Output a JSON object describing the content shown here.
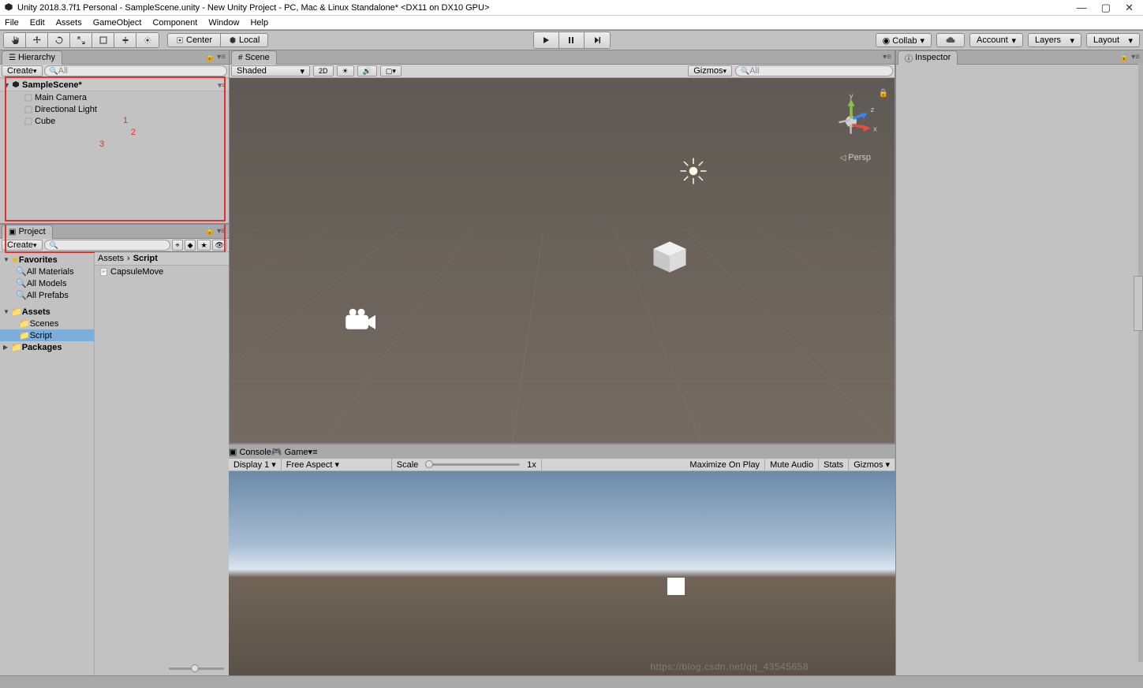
{
  "window": {
    "title": "Unity 2018.3.7f1 Personal - SampleScene.unity - New Unity Project - PC, Mac & Linux Standalone* <DX11 on DX10 GPU>"
  },
  "menu": [
    "File",
    "Edit",
    "Assets",
    "GameObject",
    "Component",
    "Window",
    "Help"
  ],
  "toolbar": {
    "center": "Center",
    "local": "Local",
    "collab": "Collab",
    "account": "Account",
    "layers": "Layers",
    "layout": "Layout"
  },
  "hierarchy": {
    "title": "Hierarchy",
    "create": "Create",
    "search_placeholder": "All",
    "scene": "SampleScene*",
    "items": [
      "Main Camera",
      "Directional Light",
      "Cube"
    ],
    "annotations": [
      "1",
      "2",
      "3"
    ]
  },
  "project": {
    "title": "Project",
    "create": "Create",
    "favorites": "Favorites",
    "fav_items": [
      "All Materials",
      "All Models",
      "All Prefabs"
    ],
    "assets": "Assets",
    "asset_items": [
      "Scenes",
      "Script"
    ],
    "packages": "Packages",
    "breadcrumb": [
      "Assets",
      "Script"
    ],
    "files": [
      "CapsuleMove"
    ]
  },
  "scene": {
    "title": "Scene",
    "shading": "Shaded",
    "btn2d": "2D",
    "gizmos": "Gizmos",
    "search_placeholder": "All",
    "persp": "Persp",
    "axes": {
      "x": "x",
      "y": "y",
      "z": "z"
    }
  },
  "inspector": {
    "title": "Inspector"
  },
  "console": {
    "title": "Console"
  },
  "game": {
    "title": "Game",
    "display": "Display 1",
    "aspect": "Free Aspect",
    "scale_label": "Scale",
    "scale_value": "1x",
    "maximize": "Maximize On Play",
    "mute": "Mute Audio",
    "stats": "Stats",
    "gizmos": "Gizmos"
  },
  "watermark": "https://blog.csdn.net/qq_43545658"
}
